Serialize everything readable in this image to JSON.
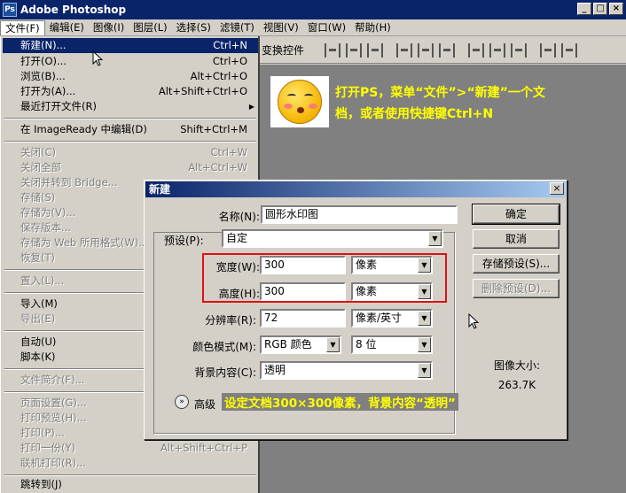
{
  "app": {
    "title": "Adobe Photoshop",
    "logo": "Ps"
  },
  "menubar": [
    "文件(F)",
    "编辑(E)",
    "图像(I)",
    "图层(L)",
    "选择(S)",
    "滤镜(T)",
    "视图(V)",
    "窗口(W)",
    "帮助(H)"
  ],
  "options_bar": {
    "label": "变换控件"
  },
  "file_menu": [
    {
      "label": "新建(N)...",
      "shortcut": "Ctrl+N"
    },
    {
      "label": "打开(O)...",
      "shortcut": "Ctrl+O"
    },
    {
      "label": "浏览(B)...",
      "shortcut": "Alt+Ctrl+O"
    },
    {
      "label": "打开为(A)...",
      "shortcut": "Alt+Shift+Ctrl+O"
    },
    {
      "label": "最近打开文件(R)",
      "shortcut": ""
    },
    {
      "label": "在 ImageReady 中编辑(D)",
      "shortcut": "Shift+Ctrl+M"
    },
    {
      "label": "关闭(C)",
      "shortcut": "Ctrl+W"
    },
    {
      "label": "关闭全部",
      "shortcut": "Alt+Ctrl+W"
    },
    {
      "label": "关闭并转到 Bridge...",
      "shortcut": ""
    },
    {
      "label": "存储(S)",
      "shortcut": ""
    },
    {
      "label": "存储为(V)...",
      "shortcut": ""
    },
    {
      "label": "保存版本...",
      "shortcut": ""
    },
    {
      "label": "存储为 Web 所用格式(W)...",
      "shortcut": ""
    },
    {
      "label": "恢复(T)",
      "shortcut": ""
    },
    {
      "label": "置入(L)...",
      "shortcut": ""
    },
    {
      "label": "导入(M)",
      "shortcut": ""
    },
    {
      "label": "导出(E)",
      "shortcut": ""
    },
    {
      "label": "自动(U)",
      "shortcut": ""
    },
    {
      "label": "脚本(K)",
      "shortcut": ""
    },
    {
      "label": "文件简介(F)...",
      "shortcut": ""
    },
    {
      "label": "页面设置(G)...",
      "shortcut": ""
    },
    {
      "label": "打印预览(H)...",
      "shortcut": ""
    },
    {
      "label": "打印(P)...",
      "shortcut": ""
    },
    {
      "label": "打印一份(Y)",
      "shortcut": "Alt+Shift+Ctrl+P"
    },
    {
      "label": "联机打印(R)...",
      "shortcut": ""
    },
    {
      "label": "跳转到(J)",
      "shortcut": ""
    }
  ],
  "note_top": {
    "line1": "打开PS，菜单“文件”>“新建”一个文",
    "line2": "档，或者使用快捷键Ctrl+N"
  },
  "dialog": {
    "title": "新建",
    "name_label": "名称(N):",
    "name_value": "圆形水印图",
    "preset_label": "预设(P):",
    "preset_value": "自定",
    "width_label": "宽度(W):",
    "width_value": "300",
    "width_unit": "像素",
    "height_label": "高度(H):",
    "height_value": "300",
    "height_unit": "像素",
    "resolution_label": "分辨率(R):",
    "resolution_value": "72",
    "resolution_unit": "像素/英寸",
    "color_mode_label": "颜色模式(M):",
    "color_mode_value": "RGB 颜色",
    "bit_depth": "8 位",
    "background_label": "背景内容(C):",
    "background_value": "透明",
    "advanced_label": "高级",
    "ok": "确定",
    "cancel": "取消",
    "save_preset": "存储预设(S)...",
    "delete_preset": "删除预设(D)...",
    "image_size_label": "图像大小:",
    "image_size_value": "263.7K"
  },
  "note_bottom": "设定文档300×300像素，背景内容“透明”"
}
